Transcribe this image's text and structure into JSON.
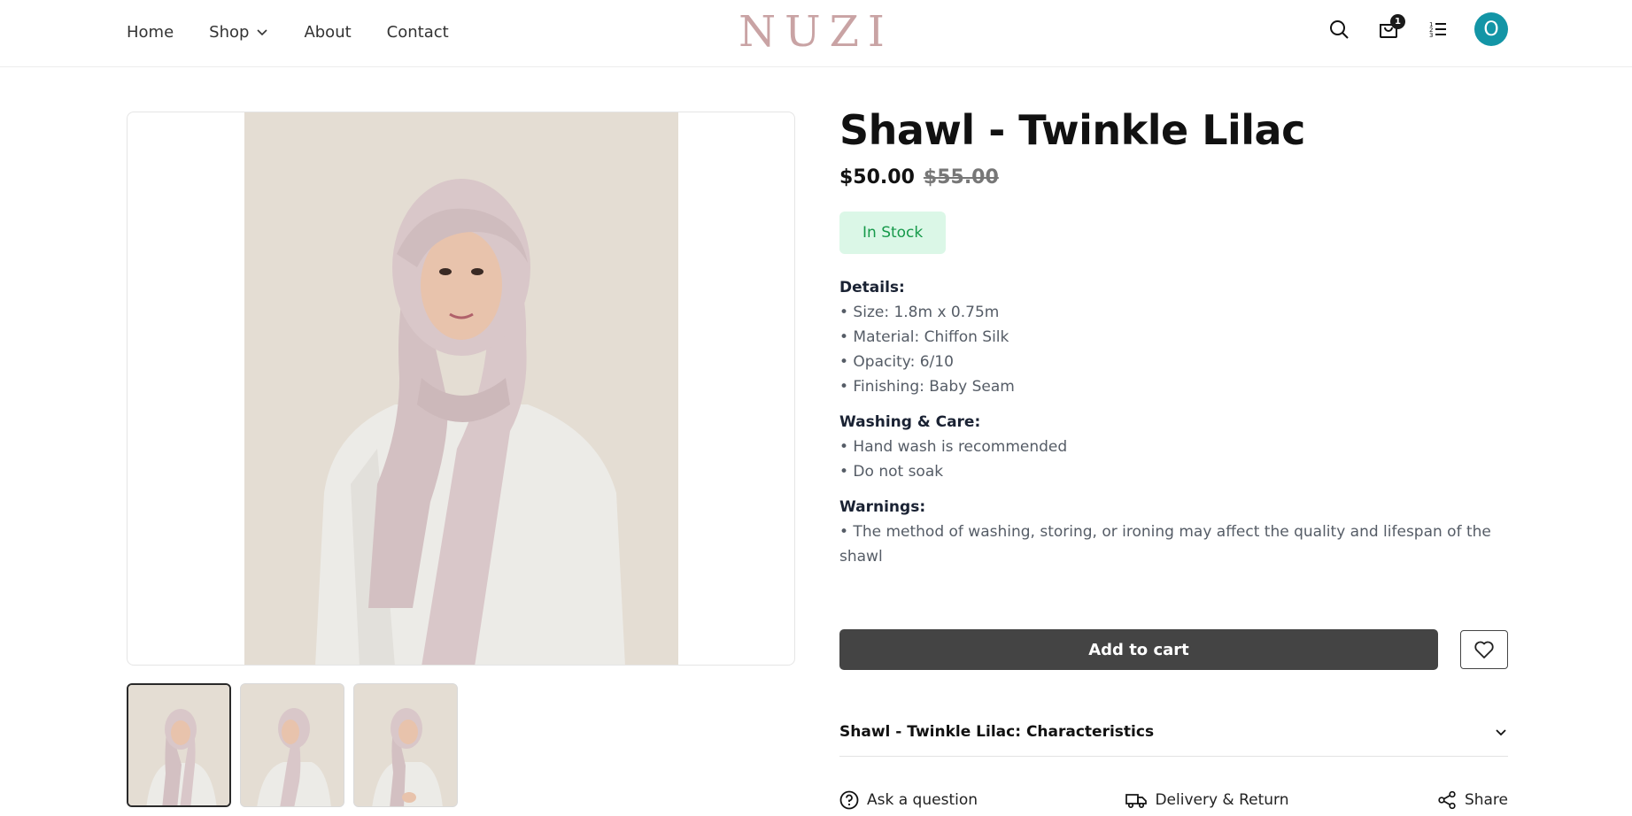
{
  "header": {
    "nav": {
      "home": "Home",
      "shop": "Shop",
      "about": "About",
      "contact": "Contact"
    },
    "logo": "NUZI",
    "cart_count": "1",
    "avatar_initial": "O",
    "icons": [
      "search-icon",
      "shopping-bag-icon",
      "list-icon",
      "user-avatar"
    ]
  },
  "product": {
    "title": "Shawl - Twinkle Lilac",
    "price": "$50.00",
    "old_price": "$55.00",
    "stock": "In Stock",
    "details": {
      "title": "Details:",
      "lines": [
        "• Size: 1.8m x 0.75m",
        "• Material: Chiffon Silk",
        "• Opacity: 6/10",
        "• Finishing: Baby Seam"
      ]
    },
    "care": {
      "title": "Washing & Care:",
      "lines": [
        "• Hand wash is recommended",
        "• Do not soak"
      ]
    },
    "warnings": {
      "title": "Warnings:",
      "lines": [
        "• The method of washing, storing, or ironing may affect the quality and lifespan of the shawl"
      ]
    },
    "add_to_cart": "Add to cart",
    "characteristics": "Shawl - Twinkle Lilac: Characteristics",
    "links": {
      "ask": "Ask a question",
      "delivery": "Delivery & Return",
      "share": "Share"
    }
  },
  "colors": {
    "accent": "#1395a6",
    "logo": "#c9a3a4",
    "stock_bg": "#dbf7e7",
    "stock_text": "#16994a",
    "button": "#444444",
    "scarf": "#d9c7c9"
  }
}
